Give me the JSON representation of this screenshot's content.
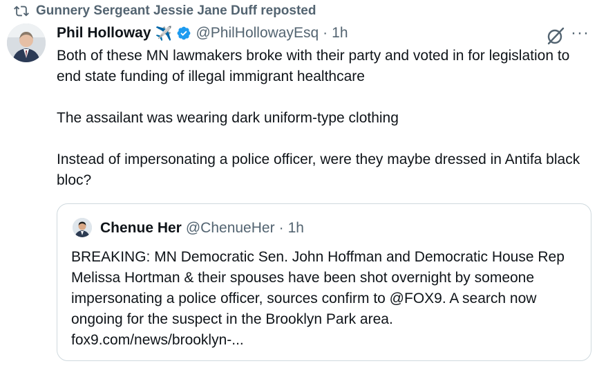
{
  "repost": {
    "icon": "repost-icon",
    "text": "Gunnery Sergeant Jessie Jane Duff reposted"
  },
  "tweet": {
    "author_name": "Phil Holloway",
    "badge_emoji": "✈️",
    "handle": "@PhilHollowayEsq",
    "separator": "·",
    "time": "1h",
    "paragraphs": [
      "Both of these MN lawmakers broke with their party and voted in for legislation to end state funding of illegal immigrant healthcare",
      "The assailant was wearing dark uniform-type clothing",
      "Instead of impersonating a police officer, were they maybe dressed in Antifa black bloc?"
    ]
  },
  "quoted": {
    "author_name": "Chenue Her",
    "handle": "@ChenueHer",
    "separator": "·",
    "time": "1h",
    "text": "BREAKING: MN Democratic Sen. John Hoffman and Democratic House Rep Melissa Hortman & their spouses have been shot overnight by someone impersonating a police officer, sources confirm to @FOX9. A search now ongoing for the suspect in the Brooklyn Park area.",
    "link": "fox9.com/news/brooklyn-..."
  },
  "more_label": "···",
  "colors": {
    "verified": "#1d9bf0",
    "secondary_text": "#536471",
    "border": "#cfd9de"
  }
}
